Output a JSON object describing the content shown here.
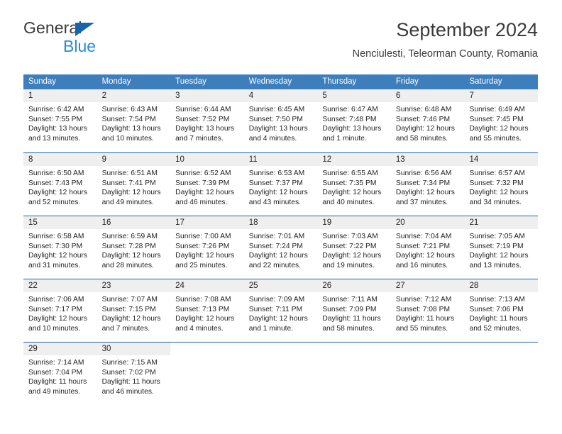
{
  "brand": {
    "name_top": "General",
    "name_bottom": "Blue",
    "triangle_color": "#1565ae",
    "blue_text_color": "#2a8bd5"
  },
  "header": {
    "title": "September 2024",
    "subtitle": "Nenciulesti, Teleorman County, Romania"
  },
  "theme": {
    "header_blue": "#3d7ebd",
    "row_divider_blue": "#1f63a8",
    "date_band_gray": "#efefef",
    "text_color": "#231f20"
  },
  "weekdays": [
    "Sunday",
    "Monday",
    "Tuesday",
    "Wednesday",
    "Thursday",
    "Friday",
    "Saturday"
  ],
  "weeks": [
    [
      {
        "day": "1",
        "sunrise": "Sunrise: 6:42 AM",
        "sunset": "Sunset: 7:55 PM",
        "daylight": "Daylight: 13 hours and 13 minutes."
      },
      {
        "day": "2",
        "sunrise": "Sunrise: 6:43 AM",
        "sunset": "Sunset: 7:54 PM",
        "daylight": "Daylight: 13 hours and 10 minutes."
      },
      {
        "day": "3",
        "sunrise": "Sunrise: 6:44 AM",
        "sunset": "Sunset: 7:52 PM",
        "daylight": "Daylight: 13 hours and 7 minutes."
      },
      {
        "day": "4",
        "sunrise": "Sunrise: 6:45 AM",
        "sunset": "Sunset: 7:50 PM",
        "daylight": "Daylight: 13 hours and 4 minutes."
      },
      {
        "day": "5",
        "sunrise": "Sunrise: 6:47 AM",
        "sunset": "Sunset: 7:48 PM",
        "daylight": "Daylight: 13 hours and 1 minute."
      },
      {
        "day": "6",
        "sunrise": "Sunrise: 6:48 AM",
        "sunset": "Sunset: 7:46 PM",
        "daylight": "Daylight: 12 hours and 58 minutes."
      },
      {
        "day": "7",
        "sunrise": "Sunrise: 6:49 AM",
        "sunset": "Sunset: 7:45 PM",
        "daylight": "Daylight: 12 hours and 55 minutes."
      }
    ],
    [
      {
        "day": "8",
        "sunrise": "Sunrise: 6:50 AM",
        "sunset": "Sunset: 7:43 PM",
        "daylight": "Daylight: 12 hours and 52 minutes."
      },
      {
        "day": "9",
        "sunrise": "Sunrise: 6:51 AM",
        "sunset": "Sunset: 7:41 PM",
        "daylight": "Daylight: 12 hours and 49 minutes."
      },
      {
        "day": "10",
        "sunrise": "Sunrise: 6:52 AM",
        "sunset": "Sunset: 7:39 PM",
        "daylight": "Daylight: 12 hours and 46 minutes."
      },
      {
        "day": "11",
        "sunrise": "Sunrise: 6:53 AM",
        "sunset": "Sunset: 7:37 PM",
        "daylight": "Daylight: 12 hours and 43 minutes."
      },
      {
        "day": "12",
        "sunrise": "Sunrise: 6:55 AM",
        "sunset": "Sunset: 7:35 PM",
        "daylight": "Daylight: 12 hours and 40 minutes."
      },
      {
        "day": "13",
        "sunrise": "Sunrise: 6:56 AM",
        "sunset": "Sunset: 7:34 PM",
        "daylight": "Daylight: 12 hours and 37 minutes."
      },
      {
        "day": "14",
        "sunrise": "Sunrise: 6:57 AM",
        "sunset": "Sunset: 7:32 PM",
        "daylight": "Daylight: 12 hours and 34 minutes."
      }
    ],
    [
      {
        "day": "15",
        "sunrise": "Sunrise: 6:58 AM",
        "sunset": "Sunset: 7:30 PM",
        "daylight": "Daylight: 12 hours and 31 minutes."
      },
      {
        "day": "16",
        "sunrise": "Sunrise: 6:59 AM",
        "sunset": "Sunset: 7:28 PM",
        "daylight": "Daylight: 12 hours and 28 minutes."
      },
      {
        "day": "17",
        "sunrise": "Sunrise: 7:00 AM",
        "sunset": "Sunset: 7:26 PM",
        "daylight": "Daylight: 12 hours and 25 minutes."
      },
      {
        "day": "18",
        "sunrise": "Sunrise: 7:01 AM",
        "sunset": "Sunset: 7:24 PM",
        "daylight": "Daylight: 12 hours and 22 minutes."
      },
      {
        "day": "19",
        "sunrise": "Sunrise: 7:03 AM",
        "sunset": "Sunset: 7:22 PM",
        "daylight": "Daylight: 12 hours and 19 minutes."
      },
      {
        "day": "20",
        "sunrise": "Sunrise: 7:04 AM",
        "sunset": "Sunset: 7:21 PM",
        "daylight": "Daylight: 12 hours and 16 minutes."
      },
      {
        "day": "21",
        "sunrise": "Sunrise: 7:05 AM",
        "sunset": "Sunset: 7:19 PM",
        "daylight": "Daylight: 12 hours and 13 minutes."
      }
    ],
    [
      {
        "day": "22",
        "sunrise": "Sunrise: 7:06 AM",
        "sunset": "Sunset: 7:17 PM",
        "daylight": "Daylight: 12 hours and 10 minutes."
      },
      {
        "day": "23",
        "sunrise": "Sunrise: 7:07 AM",
        "sunset": "Sunset: 7:15 PM",
        "daylight": "Daylight: 12 hours and 7 minutes."
      },
      {
        "day": "24",
        "sunrise": "Sunrise: 7:08 AM",
        "sunset": "Sunset: 7:13 PM",
        "daylight": "Daylight: 12 hours and 4 minutes."
      },
      {
        "day": "25",
        "sunrise": "Sunrise: 7:09 AM",
        "sunset": "Sunset: 7:11 PM",
        "daylight": "Daylight: 12 hours and 1 minute."
      },
      {
        "day": "26",
        "sunrise": "Sunrise: 7:11 AM",
        "sunset": "Sunset: 7:09 PM",
        "daylight": "Daylight: 11 hours and 58 minutes."
      },
      {
        "day": "27",
        "sunrise": "Sunrise: 7:12 AM",
        "sunset": "Sunset: 7:08 PM",
        "daylight": "Daylight: 11 hours and 55 minutes."
      },
      {
        "day": "28",
        "sunrise": "Sunrise: 7:13 AM",
        "sunset": "Sunset: 7:06 PM",
        "daylight": "Daylight: 11 hours and 52 minutes."
      }
    ],
    [
      {
        "day": "29",
        "sunrise": "Sunrise: 7:14 AM",
        "sunset": "Sunset: 7:04 PM",
        "daylight": "Daylight: 11 hours and 49 minutes."
      },
      {
        "day": "30",
        "sunrise": "Sunrise: 7:15 AM",
        "sunset": "Sunset: 7:02 PM",
        "daylight": "Daylight: 11 hours and 46 minutes."
      },
      {
        "day": "",
        "sunrise": "",
        "sunset": "",
        "daylight": ""
      },
      {
        "day": "",
        "sunrise": "",
        "sunset": "",
        "daylight": ""
      },
      {
        "day": "",
        "sunrise": "",
        "sunset": "",
        "daylight": ""
      },
      {
        "day": "",
        "sunrise": "",
        "sunset": "",
        "daylight": ""
      },
      {
        "day": "",
        "sunrise": "",
        "sunset": "",
        "daylight": ""
      }
    ]
  ]
}
